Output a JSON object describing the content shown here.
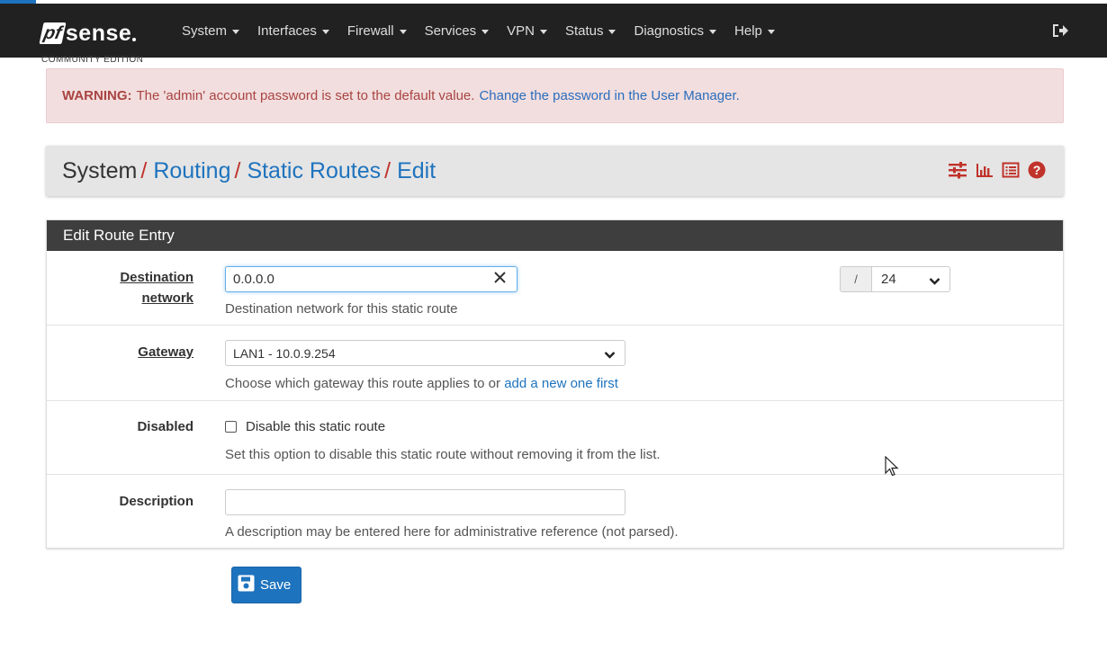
{
  "app": {
    "brand": "sense",
    "brand_mark": "pf",
    "edition": "COMMUNITY EDITION"
  },
  "nav": {
    "items": [
      {
        "label": "System"
      },
      {
        "label": "Interfaces"
      },
      {
        "label": "Firewall"
      },
      {
        "label": "Services"
      },
      {
        "label": "VPN"
      },
      {
        "label": "Status"
      },
      {
        "label": "Diagnostics"
      },
      {
        "label": "Help"
      }
    ],
    "logout_icon": "sign-out-icon"
  },
  "alert": {
    "prefix": "WARNING:",
    "message": "The 'admin' account password is set to the default value.",
    "link": "Change the password in the User Manager."
  },
  "breadcrumb": {
    "root": "System",
    "items": [
      "Routing",
      "Static Routes",
      "Edit"
    ],
    "separator": "/",
    "icons": [
      "sliders-icon",
      "bar-chart-icon",
      "list-icon",
      "help-icon"
    ]
  },
  "panel": {
    "title": "Edit Route Entry"
  },
  "form": {
    "destination": {
      "label_line1": "Destination",
      "label_line2": "network",
      "value": "0.0.0.0",
      "help": "Destination network for this static route",
      "mask_sep": "/",
      "mask_value": "24"
    },
    "gateway": {
      "label": "Gateway",
      "value": "LAN1 - 10.0.9.254",
      "help_text": "Choose which gateway this route applies to or",
      "help_link": "add a new one first"
    },
    "disabled": {
      "label": "Disabled",
      "checkbox_label": "Disable this static route",
      "checked": false,
      "help": "Set this option to disable this static route without removing it from the list."
    },
    "description": {
      "label": "Description",
      "value": "",
      "help": "A description may be entered here for administrative reference (not parsed)."
    }
  },
  "save_button": {
    "label": "Save",
    "icon": "save-icon"
  },
  "colors": {
    "navbar": "#212121",
    "accent": "#1e73be",
    "breadcrumb_sep": "#c0332b",
    "alert_bg": "#f2dede",
    "alert_text": "#a94442"
  }
}
